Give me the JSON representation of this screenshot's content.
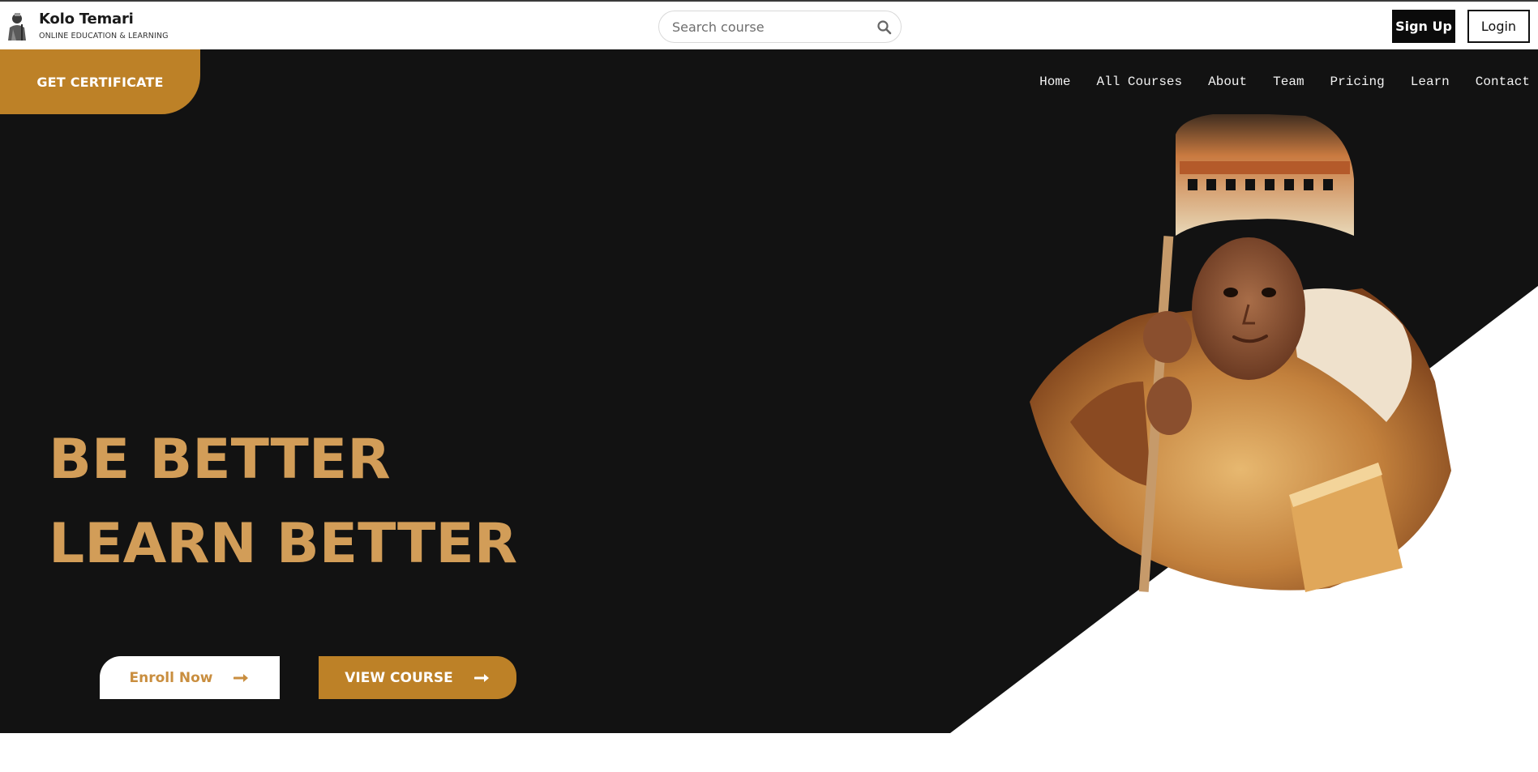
{
  "brand": {
    "name": "Kolo Temari",
    "tagline": "ONLINE EDUCATION & LEARNING",
    "avatar_icon": "person-avatar-icon"
  },
  "search": {
    "placeholder": "Search course",
    "icon": "search-icon"
  },
  "auth": {
    "signup_label": "Sign Up",
    "login_label": "Login"
  },
  "hero": {
    "certificate_label": "GET CERTIFICATE",
    "headline_line1": "BE BETTER",
    "headline_line2": "LEARN BETTER",
    "enroll_label": "Enroll Now",
    "view_course_label": "VIEW COURSE",
    "image_description_icon": "student-portrait-image"
  },
  "nav": {
    "items": [
      {
        "label": "Home"
      },
      {
        "label": "All Courses"
      },
      {
        "label": "About"
      },
      {
        "label": "Team"
      },
      {
        "label": "Pricing"
      },
      {
        "label": "Learn"
      },
      {
        "label": "Contact"
      }
    ]
  },
  "colors": {
    "accent": "#bd8127",
    "headline": "#d29d58",
    "hero_bg": "#121212",
    "white": "#ffffff"
  }
}
